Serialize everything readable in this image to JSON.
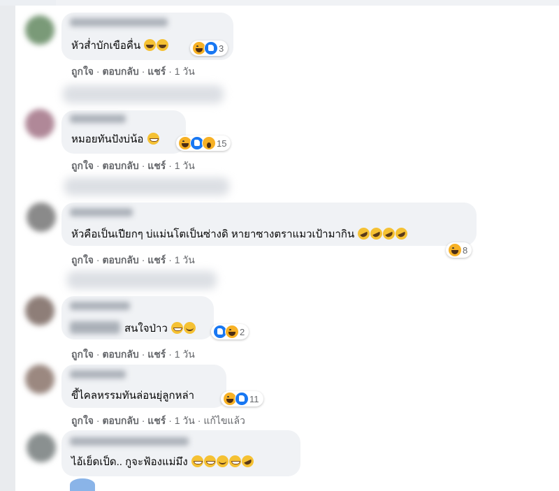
{
  "comments": [
    {
      "text": "หัวส่ำบักเขือคื่น",
      "reaction_count": "3",
      "actions": {
        "like": "ถูกใจ",
        "reply": "ตอบกลับ",
        "share": "แชร์",
        "time": "1 วัน"
      }
    },
    {
      "text": "หมอยทันปังบ่น้อ",
      "reaction_count": "15",
      "actions": {
        "like": "ถูกใจ",
        "reply": "ตอบกลับ",
        "share": "แชร์",
        "time": "1 วัน"
      }
    },
    {
      "text": "หัวคือเป็นเปียกๆ บ่แม่นโตเป็นซ่างดิ หายาซางตราแมวเป้ามากิน",
      "reaction_count": "8",
      "actions": {
        "like": "ถูกใจ",
        "reply": "ตอบกลับ",
        "share": "แชร์",
        "time": "1 วัน"
      }
    },
    {
      "text": "สนใจป่าว",
      "reaction_count": "2",
      "actions": {
        "like": "ถูกใจ",
        "reply": "ตอบกลับ",
        "share": "แชร์",
        "time": "1 วัน"
      }
    },
    {
      "text": "ขี้ไคลหรรมทันล่อนยุ่ลูกหล่า",
      "reaction_count": "11",
      "actions": {
        "like": "ถูกใจ",
        "reply": "ตอบกลับ",
        "share": "แชร์",
        "time": "1 วัน",
        "edited": "แก้ไขแล้ว"
      }
    },
    {
      "text": "ไอ้เย็ดเป็ด.. กูจะฟ้องแม่มึง"
    }
  ],
  "separator": "·",
  "icons": {
    "haha": "haha-reaction-icon",
    "like": "like-reaction-icon",
    "wow": "wow-reaction-icon"
  },
  "colors": {
    "bubble": "#f0f2f5",
    "secondary_text": "#65676b",
    "like_blue": "#1877f2",
    "haha_yellow": "#f7b125"
  }
}
